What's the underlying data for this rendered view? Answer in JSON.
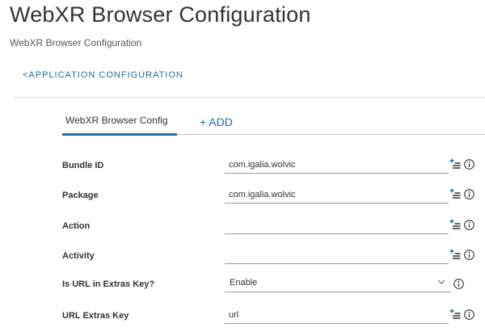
{
  "header": {
    "title": "WebXR Browser Configuration",
    "subtitle": "WebXR Browser Configuration",
    "back_link": "<APPLICATION CONFIGURATION"
  },
  "tabs": {
    "active_label": "WebXR Browser Config",
    "add_label": "+ ADD"
  },
  "fields": [
    {
      "label": "Bundle ID",
      "value": "com.igalia.wolvic",
      "type": "text"
    },
    {
      "label": "Package",
      "value": "com.igalia.wolvic",
      "type": "text"
    },
    {
      "label": "Action",
      "value": "",
      "type": "text"
    },
    {
      "label": "Activity",
      "value": "",
      "type": "text"
    },
    {
      "label": "Is URL in Extras Key?",
      "value": "Enable",
      "type": "select"
    },
    {
      "label": "URL Extras Key",
      "value": "url",
      "type": "text"
    }
  ],
  "icons": {
    "insert": "insert-lookup-value-icon",
    "info": "info-icon",
    "chevron": "chevron-down-icon"
  },
  "colors": {
    "accent": "#1a6ea2",
    "text": "#333333",
    "divider": "#dddddd"
  }
}
